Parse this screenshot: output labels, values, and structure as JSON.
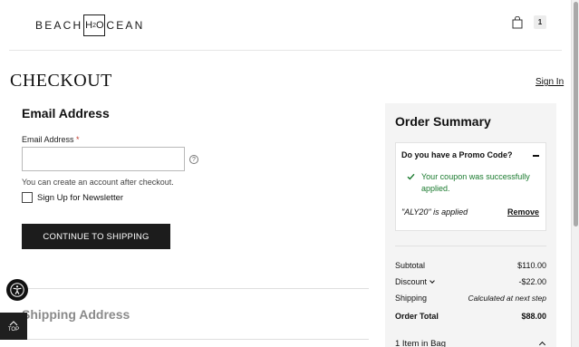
{
  "header": {
    "logo_left": "BEACH",
    "logo_mid": "H",
    "logo_sub": "2",
    "logo_mid2": "O",
    "logo_right": "CEAN",
    "bag_count": "1"
  },
  "page": {
    "title": "CHECKOUT",
    "sign_in": "Sign In"
  },
  "email_section": {
    "title": "Email Address",
    "label": "Email Address",
    "required_mark": "*",
    "input_value": "",
    "help_glyph": "?",
    "hint": "You can create an account after checkout.",
    "newsletter_label": "Sign Up for Newsletter",
    "newsletter_checked": false,
    "continue_label": "CONTINUE TO SHIPPING"
  },
  "shipping_section": {
    "title": "Shipping Address"
  },
  "floating": {
    "top_label": "TOP"
  },
  "summary": {
    "title": "Order Summary",
    "promo": {
      "heading": "Do you have a Promo Code?",
      "success": "Your coupon was successfully applied.",
      "applied": "\"ALY20\" is applied",
      "remove": "Remove"
    },
    "rows": {
      "subtotal_label": "Subtotal",
      "subtotal_value": "$110.00",
      "discount_label": "Discount",
      "discount_value": "-$22.00",
      "shipping_label": "Shipping",
      "shipping_value": "Calculated at next step",
      "total_label": "Order Total",
      "total_value": "$88.00"
    },
    "bag_items": "1 Item in Bag"
  },
  "colors": {
    "success": "#1a7a2e",
    "button": "#1c1c1c",
    "summary_bg": "#f4f4f4"
  }
}
